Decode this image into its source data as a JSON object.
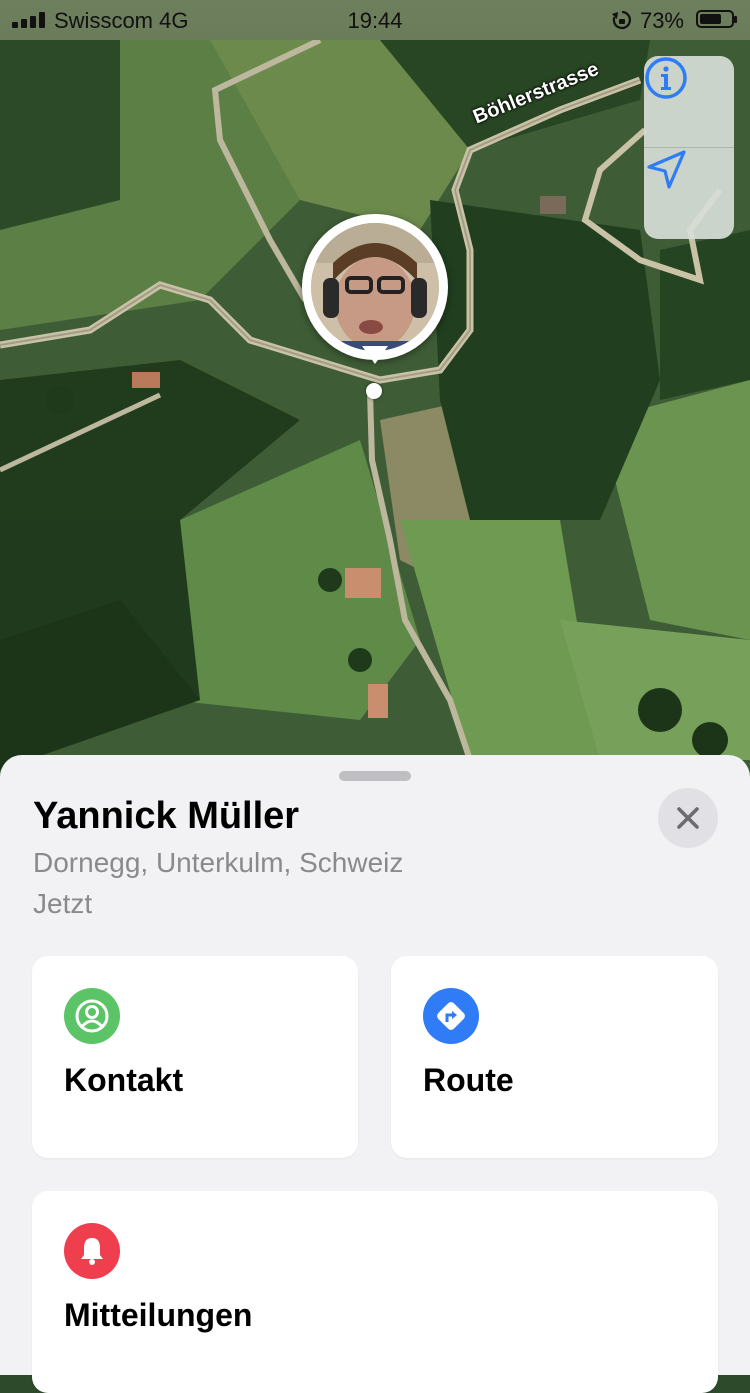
{
  "status_bar": {
    "carrier": "Swisscom",
    "network": "4G",
    "time": "19:44",
    "battery_percent": "73%",
    "battery_level": 0.73
  },
  "map": {
    "street_label": "Böhlerstrasse",
    "controls": {
      "info_icon": "info-icon",
      "location_icon": "location-arrow-icon"
    },
    "person_pin": "avatar-pin"
  },
  "sheet": {
    "name": "Yannick Müller",
    "address": "Dornegg, Unterkulm, Schweiz",
    "time_ago": "Jetzt",
    "close_icon": "close-icon",
    "actions": [
      {
        "label": "Kontakt",
        "icon": "contact-icon",
        "color": "#5ac466"
      },
      {
        "label": "Route",
        "icon": "directions-icon",
        "color": "#2f7cf6"
      },
      {
        "label": "Mitteilungen",
        "icon": "bell-icon",
        "color": "#ef3f4f"
      }
    ]
  },
  "colors": {
    "accent": "#2f7cf6",
    "sheet_bg": "#f2f2f4"
  }
}
